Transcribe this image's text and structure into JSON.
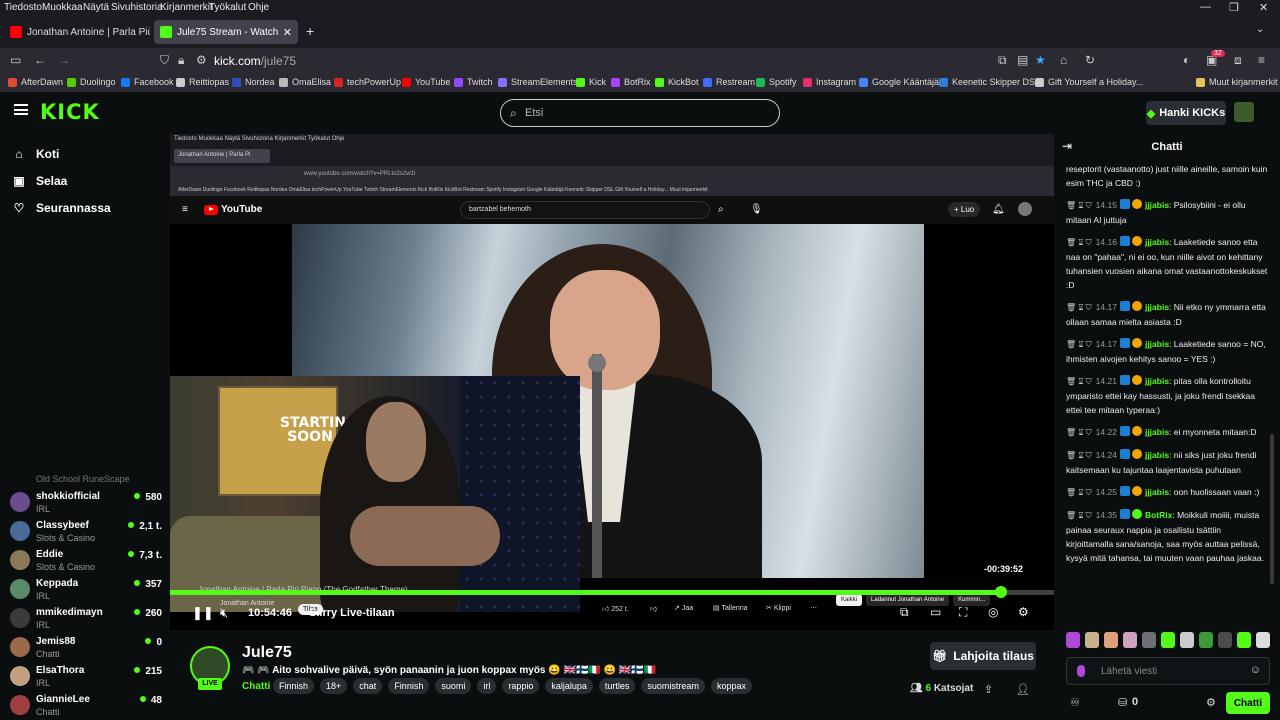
{
  "os_menu": [
    "Tiedosto",
    "Muokkaa",
    "Näytä",
    "Sivuhistoria",
    "Kirjanmerkit",
    "Työkalut",
    "Ohje"
  ],
  "tabs": [
    {
      "title": "Jonathan Antoine | Parla Più Pia",
      "active": false,
      "color": "#ff0000"
    },
    {
      "title": "Jule75 Stream - Watch Live on K",
      "active": true,
      "color": "#53fc18"
    }
  ],
  "url": {
    "host": "kick.com",
    "path": "/jule75"
  },
  "extension_badge": "32",
  "bookmarks": [
    {
      "label": "AfterDawn",
      "color": "#e04a2f"
    },
    {
      "label": "Duolingo",
      "color": "#58cc02"
    },
    {
      "label": "Facebook",
      "color": "#1877f2"
    },
    {
      "label": "Reittiopas",
      "color": "#cccccc"
    },
    {
      "label": "Nordea",
      "color": "#0000a0"
    },
    {
      "label": "OmaElisa",
      "color": "#bbbbbb"
    },
    {
      "label": "techPowerUp",
      "color": "#d22"
    },
    {
      "label": "YouTube",
      "color": "#ff0000"
    },
    {
      "label": "Twitch",
      "color": "#9146ff"
    },
    {
      "label": "StreamElements",
      "color": "#8a6dff"
    },
    {
      "label": "Kick",
      "color": "#53fc18"
    },
    {
      "label": "BotRix",
      "color": "#aa44ff"
    },
    {
      "label": "KickBot",
      "color": "#53fc18"
    },
    {
      "label": "Restream",
      "color": "#3f6bff"
    },
    {
      "label": "Spotify",
      "color": "#1db954"
    },
    {
      "label": "Instagram",
      "color": "#e1306c"
    },
    {
      "label": "Google Kääntäjä",
      "color": "#4285f4"
    },
    {
      "label": "Keenetic Skipper DSL",
      "color": "#2d7fd6"
    },
    {
      "label": "Gift Yourself a Holiday...",
      "color": "#cccccc"
    },
    {
      "label": "Muut kirjanmerkit",
      "color": "#e6c25a"
    }
  ],
  "header": {
    "logo": "KICK",
    "search_placeholder": "Etsi",
    "kicks_button": "Hanki KICKs"
  },
  "nav": [
    {
      "label": "Koti",
      "icon": "home-icon"
    },
    {
      "label": "Selaa",
      "icon": "browse-icon"
    },
    {
      "label": "Seurannassa",
      "icon": "heart-icon"
    }
  ],
  "channels_partial": "Old School RuneScape",
  "channels": [
    {
      "name": "shokkiofficial",
      "category": "IRL",
      "viewers": "580",
      "color": "#6a4c8f"
    },
    {
      "name": "Classybeef",
      "category": "Slots & Casino",
      "viewers": "2,1 t.",
      "color": "#4a6a9a"
    },
    {
      "name": "Eddie",
      "category": "Slots & Casino",
      "viewers": "7,3 t.",
      "color": "#8a7a5a"
    },
    {
      "name": "Keppada",
      "category": "IRL",
      "viewers": "357",
      "color": "#5a8a6a"
    },
    {
      "name": "mmikedimayn",
      "category": "IRL",
      "viewers": "260",
      "color": "#3a3a3a"
    },
    {
      "name": "Jemis88",
      "category": "Chatti",
      "viewers": "0",
      "color": "#9a6a4a"
    },
    {
      "name": "ElsaThora",
      "category": "IRL",
      "viewers": "215",
      "color": "#c0a080"
    },
    {
      "name": "GiannieLee",
      "category": "Chatti",
      "viewers": "48",
      "color": "#a04040"
    }
  ],
  "inner_browser": {
    "menu": "Tiedosto  Muokkaa  Näytä  Sivuhistoria  Kirjanmerkit  Työkalut  Ohje",
    "tab": "Jonathan Antoine | Parla Pi",
    "url": "www.youtube.com/watch?v=PRLto2s2w1I",
    "bookmarks": "AfterDawn  Duolingo  Facebook  Reittiopas  Nordea  OmaElisa  techPowerUp  YouTube  Twitch  StreamElements  Kick  BotRix  KickBot  Restream  Spotify  Instagram  Google Kääntäjä  Keenetic Skipper DSL  Gift Yourself a Holiday...  Muut kirjanmerkit",
    "yt_logo": "YouTube",
    "yt_search": "bartzabel behemoth",
    "yt_create": "+ Luo"
  },
  "webcam": {
    "poster_text": "STARTING SOON"
  },
  "player": {
    "remaining": "-00:39:52",
    "video_title": "Jonathan Antoine | Parla Più Piano (The Godfather Theme)",
    "elapsed": "10:54:46",
    "live_label": "Siirry Live-tilaan",
    "progress": 0.94,
    "yt_channel": "Jonathan Antoine",
    "yt_subscribe": "Tilaa",
    "yt_likes": "252 t.",
    "yt_share": "Jaa",
    "yt_save": "Tallenna",
    "yt_clip": "Klippi",
    "yt_chips": [
      "Kaikki",
      "Ladannut Jonathan Antoine",
      "Kummin..."
    ]
  },
  "channel": {
    "name": "Jule75",
    "live_badge": "LIVE",
    "title": "🎮 🎮 Aito sohvalive päivä, syön panaanin ja juon koppax myös 😀  🇬🇧🇫🇮🇮🇹  😀  🇬🇧🇫🇮🇮🇹",
    "category": "Chatti",
    "tags": [
      "Finnish",
      "18+",
      "chat",
      "Finnish",
      "suomi",
      "irl",
      "rappio",
      "kaljalupa",
      "turtles",
      "suomistream",
      "koppax"
    ],
    "subscribe_button": "Lahjoita tilaus",
    "viewers_count": "6",
    "viewers_label": "Katsojat"
  },
  "chat": {
    "title": "Chatti",
    "messages": [
      {
        "time": "",
        "user": "",
        "text": "reseptorit (vastaanotto) just niille aineille, samoin kuin esim THC ja CBD :)"
      },
      {
        "time": "14.15",
        "user": "jjjabis",
        "text": "Psilosybiini - ei ollu mitaan AI juttuja"
      },
      {
        "time": "14.16",
        "user": "jjjabis",
        "text": "Laaketiede sanoo etta naa on \"pahaa\", ni ei oo, kun niille aivot on kehittany tuhansien vuosien aikana omat vastaanottokeskukset :D"
      },
      {
        "time": "14.17",
        "user": "jjjabis",
        "text": "Nii etko ny ymmarra etta ollaan samaa mielta asiasta :D"
      },
      {
        "time": "14.17",
        "user": "jjjabis",
        "text": "Laaketiede sanoo = NO, ihmisten aivojen kehitys sanoo = YES :)"
      },
      {
        "time": "14.21",
        "user": "jjjabis",
        "text": "pitas olla kontrolloitu ymparisto ettei kay hassusti, ja joku frendi tsekkaa ettei tee mitaan typeraa:)"
      },
      {
        "time": "14.22",
        "user": "jjjabis",
        "text": "ei myonneta mitaan:D"
      },
      {
        "time": "14.24",
        "user": "jjjabis",
        "text": "nii siks just joku frendi kaitsemaan ku tajuntaa laajentavista puhutaan"
      },
      {
        "time": "14.25",
        "user": "jjjabis",
        "text": "oon huolissaan vaan :)"
      },
      {
        "time": "14.35",
        "user": "BotRix",
        "text": "Moikkuli moiiii, muista painaa seuraux nappia ja osallistu tsättiin kirjoittamalla sana/sanoja, saa myös auttaa pelissä, kysyä mitä tahansa, tai muuten vaan pauhaa jaskaa."
      }
    ],
    "input_placeholder": "Lähetä viesti",
    "points": "0",
    "send_button": "Chatti"
  },
  "colors": {
    "accent": "#53fc18",
    "background": "#0b0e0f",
    "panel": "#2a2e33"
  }
}
